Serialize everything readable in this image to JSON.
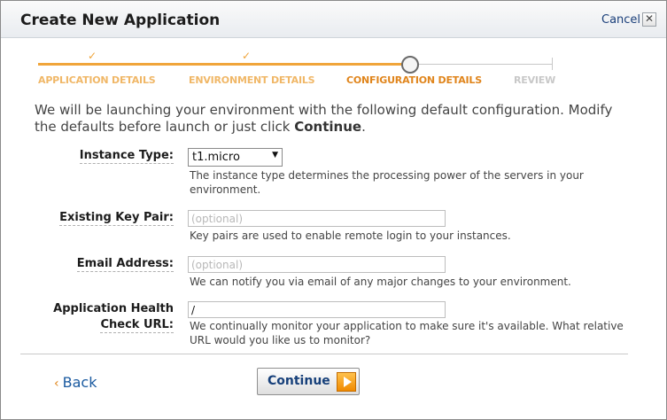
{
  "dialog": {
    "title": "Create New Application",
    "cancel_label": "Cancel",
    "close_glyph": "✕"
  },
  "progress": {
    "check_glyph": "✓",
    "steps": [
      {
        "label": "APPLICATION DETAILS",
        "state": "done"
      },
      {
        "label": "ENVIRONMENT DETAILS",
        "state": "done"
      },
      {
        "label": "CONFIGURATION DETAILS",
        "state": "current"
      },
      {
        "label": "REVIEW",
        "state": "todo"
      }
    ]
  },
  "intro": {
    "text_before": "We will be launching your environment with the following default configuration. Modify the defaults before launch or just click ",
    "emphasis": "Continue",
    "text_after": "."
  },
  "form": {
    "instance_type": {
      "label": "Instance Type:",
      "value": "t1.micro",
      "help": "The instance type determines the processing power of the servers in your environment."
    },
    "key_pair": {
      "label": "Existing Key Pair:",
      "value": "",
      "placeholder": "(optional)",
      "help": "Key pairs are used to enable remote login to your instances."
    },
    "email": {
      "label": "Email Address:",
      "value": "",
      "placeholder": "(optional)",
      "help": "We can notify you via email of any major changes to your environment."
    },
    "health_url": {
      "label_line1": "Application Health",
      "label_line2": "Check URL:",
      "value": "/",
      "help": "We continually monitor your application to make sure it's available. What relative URL would you like us to monitor?"
    }
  },
  "footer": {
    "back_label": "Back",
    "back_glyph": "‹",
    "continue_label": "Continue"
  },
  "colors": {
    "accent_orange": "#f0a53a",
    "link_blue": "#1a5aa0"
  }
}
